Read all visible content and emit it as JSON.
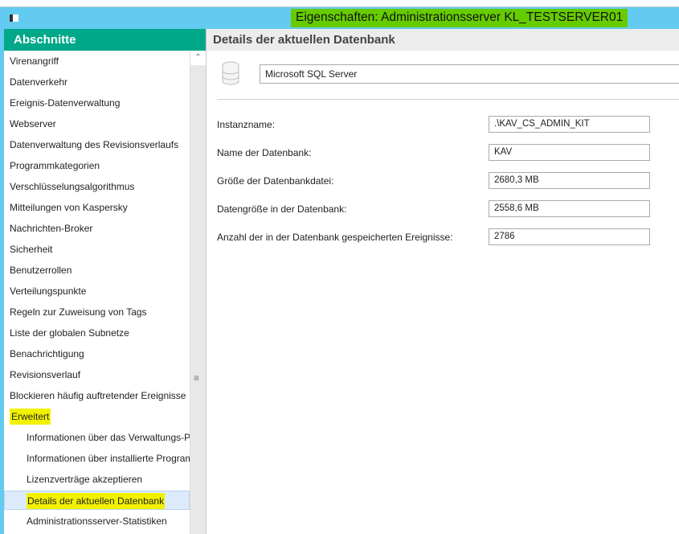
{
  "window": {
    "title": "Eigenschaften: Administrationsserver KL_TESTSERVER01"
  },
  "sidebar": {
    "header": "Abschnitte",
    "items": [
      "Virenangriff",
      "Datenverkehr",
      "Ereignis-Datenverwaltung",
      "Webserver",
      "Datenverwaltung des Revisionsverlaufs",
      "Programmkategorien",
      "Verschlüsselungsalgorithmus",
      "Mitteilungen von Kaspersky",
      "Nachrichten-Broker",
      "Sicherheit",
      "Benutzerrollen",
      "Verteilungspunkte",
      "Regeln zur Zuweisung von Tags",
      "Liste der globalen Subnetze",
      "Benachrichtigung",
      "Revisionsverlauf",
      "Blockieren häufig auftretender Ereignisse",
      "Erweitert"
    ],
    "subitems": [
      "Informationen über das Verwaltungs-Pl",
      "Informationen über installierte Program",
      "Lizenzverträge akzeptieren",
      "Details der aktuellen Datenbank",
      "Administrationsserver-Statistiken"
    ],
    "selected": "Details der aktuellen Datenbank"
  },
  "main": {
    "title": "Details der aktuellen Datenbank",
    "provider": "Microsoft SQL Server",
    "fields": [
      {
        "label": "Instanzname:",
        "value": ".\\KAV_CS_ADMIN_KIT"
      },
      {
        "label": "Name der Datenbank:",
        "value": "KAV"
      },
      {
        "label": "Größe der Datenbankdatei:",
        "value": "2680,3 MB"
      },
      {
        "label": "Datengröße in der Datenbank:",
        "value": "2558,6 MB"
      },
      {
        "label": "Anzahl der in der Datenbank gespeicherten Ereignisse:",
        "value": "2786"
      }
    ]
  }
}
